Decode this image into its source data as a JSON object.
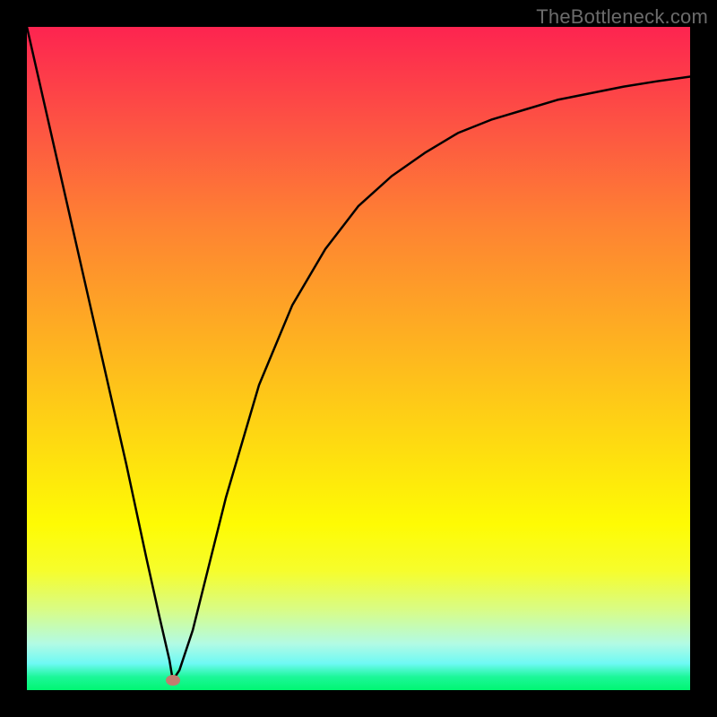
{
  "watermark": "TheBottleneck.com",
  "chart_data": {
    "type": "line",
    "title": "",
    "xlabel": "",
    "ylabel": "",
    "xlim": [
      0,
      100
    ],
    "ylim": [
      0,
      100
    ],
    "grid": false,
    "legend": false,
    "marker": {
      "x": 22,
      "y": 1.5,
      "color": "#c17d6f"
    },
    "series": [
      {
        "name": "curve",
        "x": [
          0,
          5,
          10,
          15,
          18,
          20,
          21.5,
          22,
          23,
          25,
          27,
          30,
          35,
          40,
          45,
          50,
          55,
          60,
          65,
          70,
          75,
          80,
          85,
          90,
          95,
          100
        ],
        "y": [
          100,
          78,
          56,
          34,
          20,
          11,
          4.5,
          1.5,
          3,
          9,
          17,
          29,
          46,
          58,
          66.5,
          73,
          77.5,
          81,
          84,
          86,
          87.5,
          89,
          90,
          91,
          91.8,
          92.5
        ]
      }
    ],
    "background_gradient": {
      "type": "vertical",
      "stops": [
        {
          "pos": 0.0,
          "color": "#fd2450"
        },
        {
          "pos": 0.16,
          "color": "#fd5742"
        },
        {
          "pos": 0.3,
          "color": "#fe8332"
        },
        {
          "pos": 0.45,
          "color": "#feab23"
        },
        {
          "pos": 0.6,
          "color": "#fed314"
        },
        {
          "pos": 0.75,
          "color": "#fefb04"
        },
        {
          "pos": 0.82,
          "color": "#f6fd2c"
        },
        {
          "pos": 0.88,
          "color": "#d8fc88"
        },
        {
          "pos": 0.93,
          "color": "#b2fbe4"
        },
        {
          "pos": 0.96,
          "color": "#6ef9f4"
        },
        {
          "pos": 0.98,
          "color": "#1df799"
        },
        {
          "pos": 1.0,
          "color": "#00f672"
        }
      ]
    }
  }
}
